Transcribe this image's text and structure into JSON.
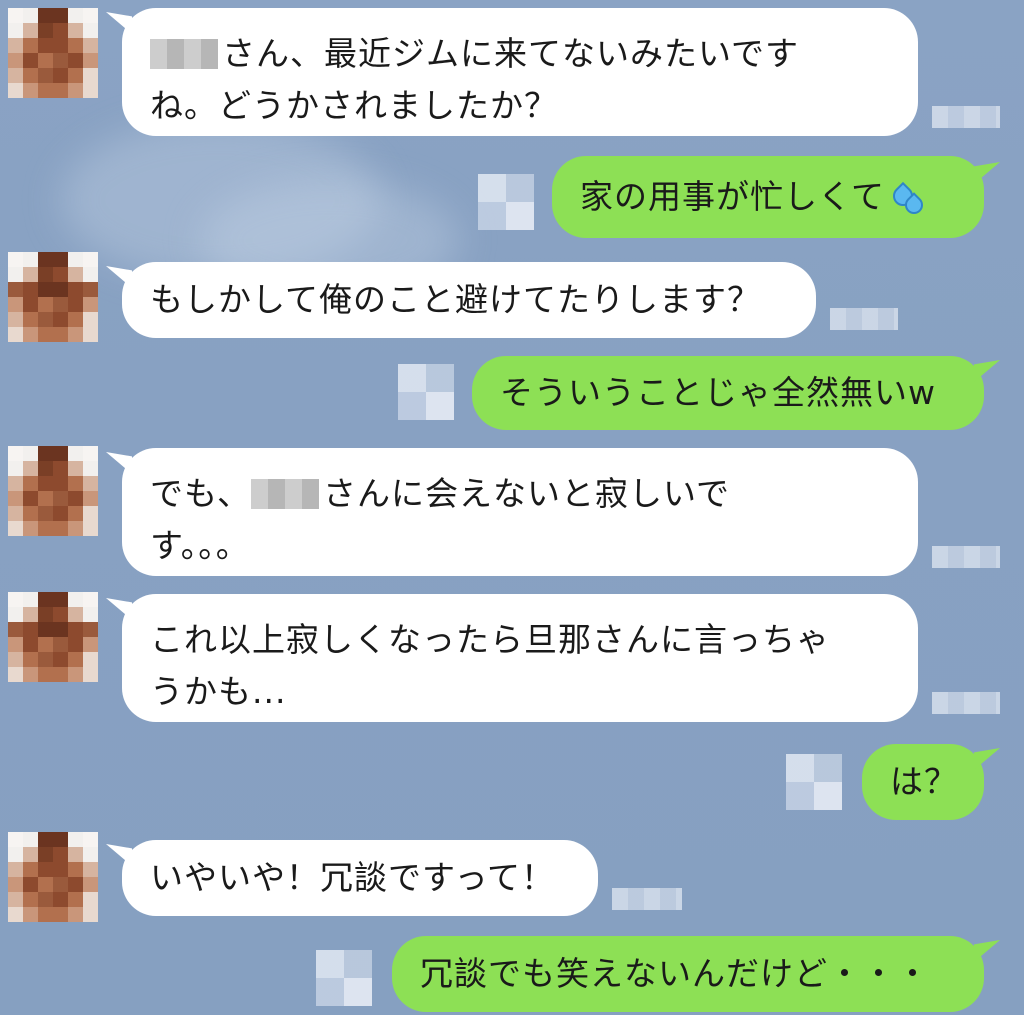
{
  "chat": {
    "messages": [
      {
        "side": "in",
        "pre_blur": true,
        "line1": "さん、最近ジムに来てないみたいです",
        "line2": "ね。どうかされましたか？"
      },
      {
        "side": "out",
        "text": "家の用事が忙しくて",
        "emoji": "sweat-drops-icon"
      },
      {
        "side": "in",
        "text": "もしかして俺のこと避けてたりします？"
      },
      {
        "side": "out",
        "text": "そういうことじゃ全然無いw"
      },
      {
        "side": "in",
        "line1_pre": "でも、",
        "line1_post": "さんに会えないと寂しいで",
        "line2": "す。。。"
      },
      {
        "side": "in",
        "line1": "これ以上寂しくなったら旦那さんに言っちゃ",
        "line2": "うかも..."
      },
      {
        "side": "out",
        "text": "は？"
      },
      {
        "side": "in",
        "text": "いやいや！冗談ですって！"
      },
      {
        "side": "out",
        "text": "冗談でも笑えないんだけど・・・"
      }
    ]
  },
  "colors": {
    "background": "#88a1c2",
    "incoming_bubble": "#ffffff",
    "outgoing_bubble": "#8de055"
  }
}
